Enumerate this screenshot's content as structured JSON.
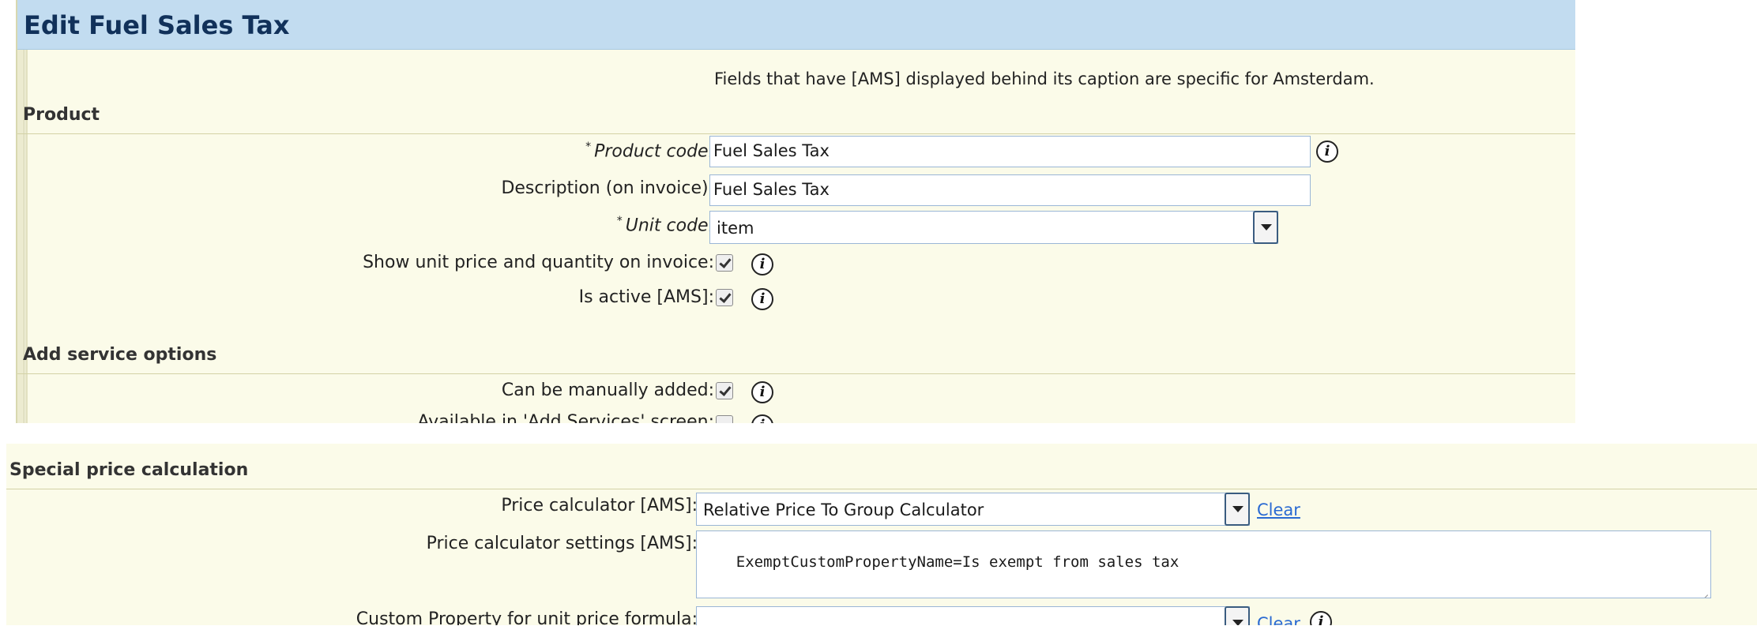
{
  "page": {
    "title": "Edit Fuel Sales Tax"
  },
  "note": "Fields that have [AMS] displayed behind its caption are specific for Amsterdam.",
  "product": {
    "heading": "Product",
    "product_code": {
      "label": "Product code:",
      "required": "*",
      "value": "Fuel Sales Tax"
    },
    "description": {
      "label": "Description (on invoice):",
      "value": "Fuel Sales Tax"
    },
    "unit_code": {
      "label": "Unit code:",
      "required": "*",
      "value": "item"
    },
    "show_unit_price": {
      "label": "Show unit price and quantity on invoice:",
      "checked": true
    },
    "is_active": {
      "label": "Is active [AMS]:",
      "checked": true
    }
  },
  "add_service": {
    "heading": "Add service options",
    "manually_added": {
      "label": "Can be manually added:",
      "checked": true
    },
    "available_in_add_services": {
      "label": "Available in 'Add Services' screen:",
      "checked": false
    }
  },
  "special_price": {
    "heading": "Special price calculation",
    "price_calculator": {
      "label": "Price calculator [AMS]:",
      "value": "Relative Price To Group Calculator",
      "clear": "Clear"
    },
    "price_calculator_settings": {
      "label": "Price calculator settings [AMS]:",
      "value": "ExemptCustomPropertyName=Is exempt from sales tax"
    },
    "custom_property": {
      "label": "Custom Property for unit price formula:",
      "value": "",
      "clear": "Clear"
    }
  },
  "icons": {
    "info": "i"
  }
}
